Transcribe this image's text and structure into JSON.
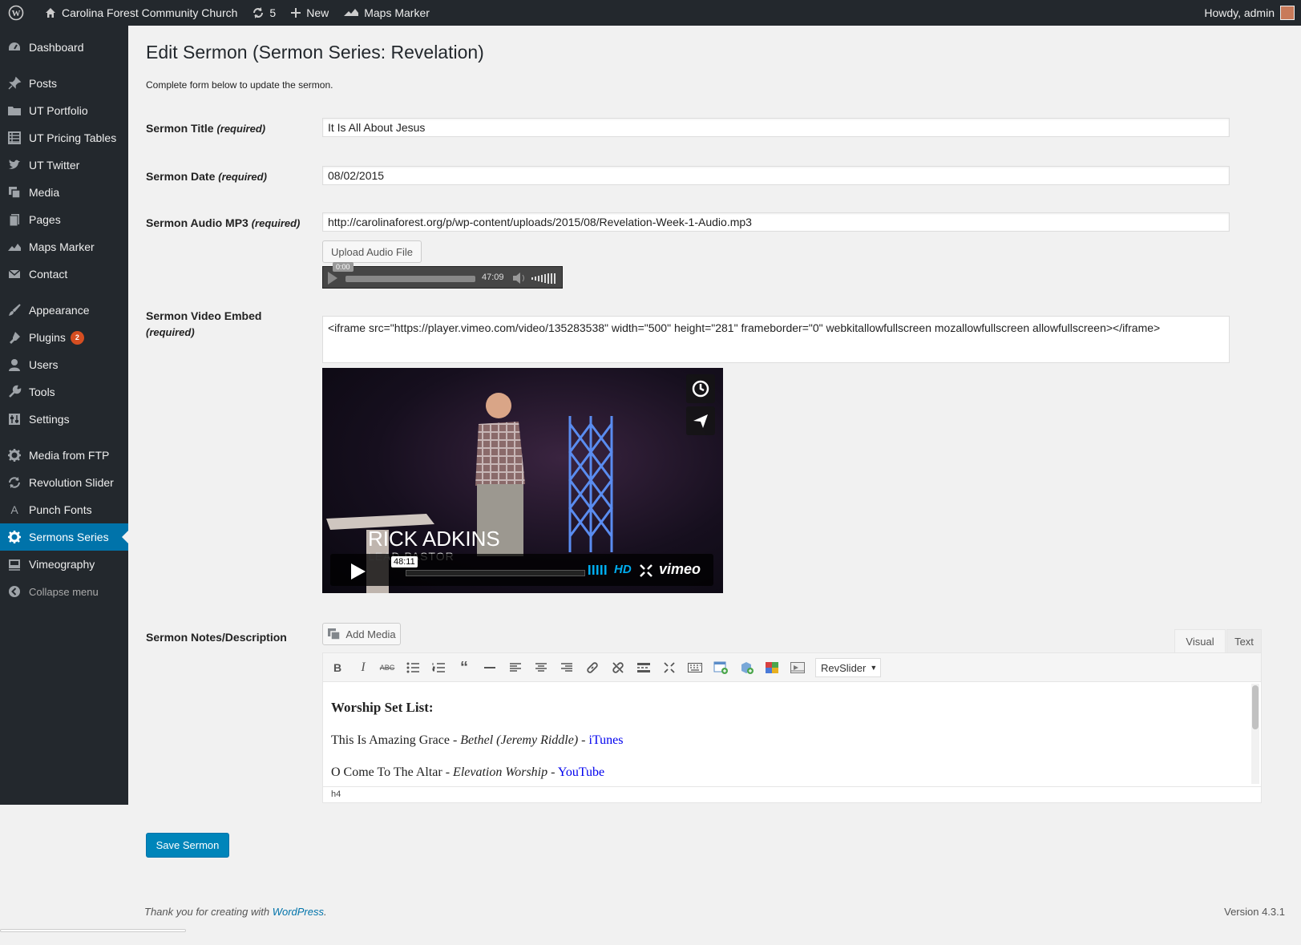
{
  "admin_bar": {
    "site_name": "Carolina Forest Community Church",
    "updates_count": "5",
    "new_label": "New",
    "maps_marker_label": "Maps Marker",
    "greeting": "Howdy, admin"
  },
  "sidebar": {
    "items": [
      {
        "label": "Dashboard",
        "icon": "dashboard-icon"
      },
      {
        "label": "Posts",
        "icon": "pin-icon"
      },
      {
        "label": "UT Portfolio",
        "icon": "folder-icon"
      },
      {
        "label": "UT Pricing Tables",
        "icon": "table-icon"
      },
      {
        "label": "UT Twitter",
        "icon": "twitter-icon"
      },
      {
        "label": "Media",
        "icon": "media-icon"
      },
      {
        "label": "Pages",
        "icon": "pages-icon"
      },
      {
        "label": "Maps Marker",
        "icon": "map-icon"
      },
      {
        "label": "Contact",
        "icon": "mail-icon"
      },
      {
        "label": "Appearance",
        "icon": "brush-icon"
      },
      {
        "label": "Plugins",
        "icon": "plugin-icon",
        "badge": "2"
      },
      {
        "label": "Users",
        "icon": "user-icon"
      },
      {
        "label": "Tools",
        "icon": "wrench-icon"
      },
      {
        "label": "Settings",
        "icon": "settings-icon"
      },
      {
        "label": "Media from FTP",
        "icon": "gear-icon"
      },
      {
        "label": "Revolution Slider",
        "icon": "refresh-icon"
      },
      {
        "label": "Punch Fonts",
        "icon": "font-icon"
      },
      {
        "label": "Sermons Series",
        "icon": "gear-icon"
      },
      {
        "label": "Vimeography",
        "icon": "video-icon"
      }
    ],
    "collapse_label": "Collapse menu",
    "active_color": "#0073aa"
  },
  "page": {
    "title": "Edit Sermon (Sermon Series: Revelation)",
    "intro": "Complete form below to update the sermon."
  },
  "form": {
    "title_label": "Sermon Title",
    "title_value": "It Is All About Jesus",
    "date_label": "Sermon Date",
    "date_value": "08/02/2015",
    "audio_label": "Sermon Audio MP3",
    "audio_value": "http://carolinaforest.org/p/wp-content/uploads/2015/08/Revelation-Week-1-Audio.mp3",
    "upload_button": "Upload Audio File",
    "audio_current": "0:00",
    "audio_duration": "47:09",
    "video_label": "Sermon Video Embed",
    "video_value": "<iframe src=\"https://player.vimeo.com/video/135283538\" width=\"500\" height=\"281\" frameborder=\"0\" webkitallowfullscreen mozallowfullscreen allowfullscreen></iframe>",
    "required_text": "(required)",
    "notes_label": "Sermon Notes/Description"
  },
  "video": {
    "speaker_name": "RICK ADKINS",
    "speaker_title": "LEAD PASTOR",
    "duration": "48:11",
    "hd_label": "HD",
    "logo": "vimeo"
  },
  "editor": {
    "add_media": "Add Media",
    "tab_visual": "Visual",
    "tab_text": "Text",
    "revslider": "RevSlider",
    "heading": "Worship Set List:",
    "line1_song": "This Is Amazing Grace",
    "line1_artist": "Bethel (Jeremy Riddle)",
    "line1_link": "iTunes",
    "line2_song": "O Come To The Altar",
    "line2_artist": "Elevation Worship",
    "line2_link": "YouTube",
    "separator": " - ",
    "status_path": "h4"
  },
  "save_button": "Save Sermon",
  "footer": {
    "thanks_prefix": "Thank you for creating with ",
    "thanks_link": "WordPress",
    "thanks_suffix": ".",
    "version": "Version 4.3.1"
  }
}
